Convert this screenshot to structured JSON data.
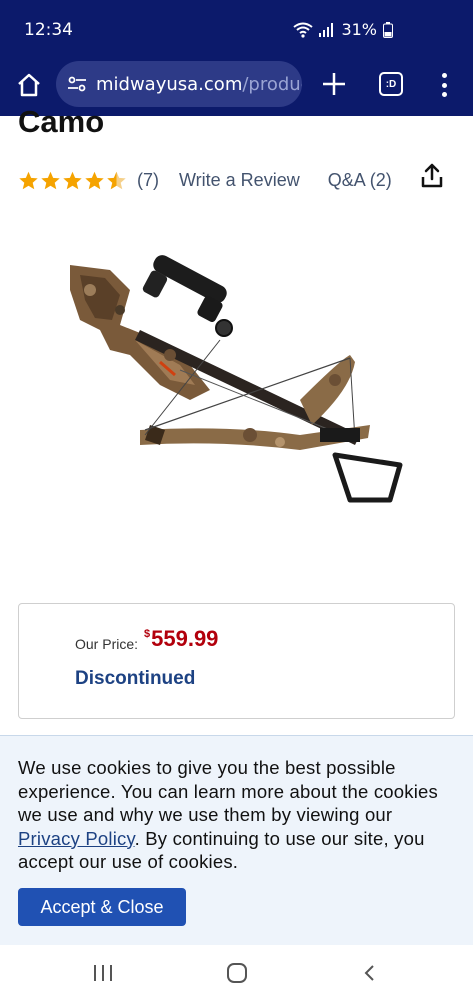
{
  "status_bar": {
    "time": "12:34",
    "battery_percent": "31%",
    "icons": [
      "wifi-icon",
      "signal-icon",
      "battery-icon"
    ]
  },
  "browser": {
    "url_domain": "midwayusa.com",
    "url_path": "/product",
    "tab_icon_label": ":D"
  },
  "product": {
    "title_partial": "Camo",
    "rating": 4.5,
    "review_count": "(7)",
    "write_review_label": "Write a Review",
    "qa_label": "Q&A (2)",
    "price_label": "Our Price:",
    "price_currency": "$",
    "price_value": "559.99",
    "status": "Discontinued"
  },
  "cookie_banner": {
    "text_before_link": "We use cookies to give you the best possible experience. You can learn more about the cookies we use and why we use them by viewing our ",
    "link_text": "Privacy Policy",
    "text_after_link": ". By continuing to use our site, you accept our use of cookies.",
    "accept_label": "Accept & Close"
  },
  "colors": {
    "browser_bar": "#0c1a6b",
    "price": "#b2000c",
    "link": "#1d4283",
    "accept_button": "#2051b3",
    "star": "#f5a300"
  }
}
